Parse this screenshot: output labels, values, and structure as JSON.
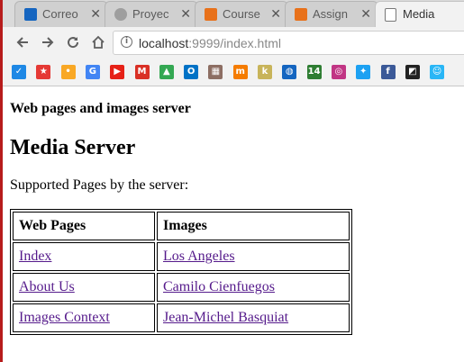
{
  "browser": {
    "tabs": [
      {
        "title": "Correo",
        "color": "#1565c0"
      },
      {
        "title": "Proyec",
        "color": "#888888"
      },
      {
        "title": "Course",
        "color": "#e8711a"
      },
      {
        "title": "Assign",
        "color": "#e8711a"
      },
      {
        "title": "Media",
        "color": "#ffffff"
      }
    ],
    "url_host": "localhost",
    "url_path": ":9999/index.html",
    "bookmarks": [
      {
        "icon": "check-icon",
        "color": "#1e88e5",
        "glyph": "✓"
      },
      {
        "icon": "bookmark-red-icon",
        "color": "#e53935",
        "glyph": "★"
      },
      {
        "icon": "keep-icon",
        "color": "#f9a825",
        "glyph": "•"
      },
      {
        "icon": "translate-icon",
        "color": "#4285f4",
        "glyph": "G"
      },
      {
        "icon": "youtube-icon",
        "color": "#e62117",
        "glyph": "▶"
      },
      {
        "icon": "gmail-icon",
        "color": "#d93025",
        "glyph": "M"
      },
      {
        "icon": "drive-icon",
        "color": "#34a853",
        "glyph": "▲"
      },
      {
        "icon": "outlook-icon",
        "color": "#0072c6",
        "glyph": "O"
      },
      {
        "icon": "picture-icon",
        "color": "#8d6e63",
        "glyph": "▦"
      },
      {
        "icon": "moodle-icon",
        "color": "#f57c00",
        "glyph": "m"
      },
      {
        "icon": "khan-icon",
        "color": "#c8b45a",
        "glyph": "k"
      },
      {
        "icon": "globe-icon",
        "color": "#1565c0",
        "glyph": "◍"
      },
      {
        "icon": "badge-14-icon",
        "color": "#2e7d32",
        "glyph": "14"
      },
      {
        "icon": "instagram-icon",
        "color": "#c13584",
        "glyph": "◎"
      },
      {
        "icon": "twitter-icon",
        "color": "#1da1f2",
        "glyph": "✦"
      },
      {
        "icon": "facebook-icon",
        "color": "#3b5998",
        "glyph": "f"
      },
      {
        "icon": "yellow-black-icon",
        "color": "#222222",
        "glyph": "◩"
      },
      {
        "icon": "smile-icon",
        "color": "#29b6f6",
        "glyph": "☺"
      }
    ]
  },
  "page": {
    "subtitle": "Web pages and images server",
    "title": "Media Server",
    "intro": "Supported Pages by the server:",
    "table": {
      "headers": [
        "Web Pages",
        "Images"
      ],
      "rows": [
        [
          "Index",
          "Los Angeles"
        ],
        [
          "About Us",
          "Camilo Cienfuegos"
        ],
        [
          "Images Context",
          "Jean-Michel Basquiat"
        ]
      ]
    }
  }
}
